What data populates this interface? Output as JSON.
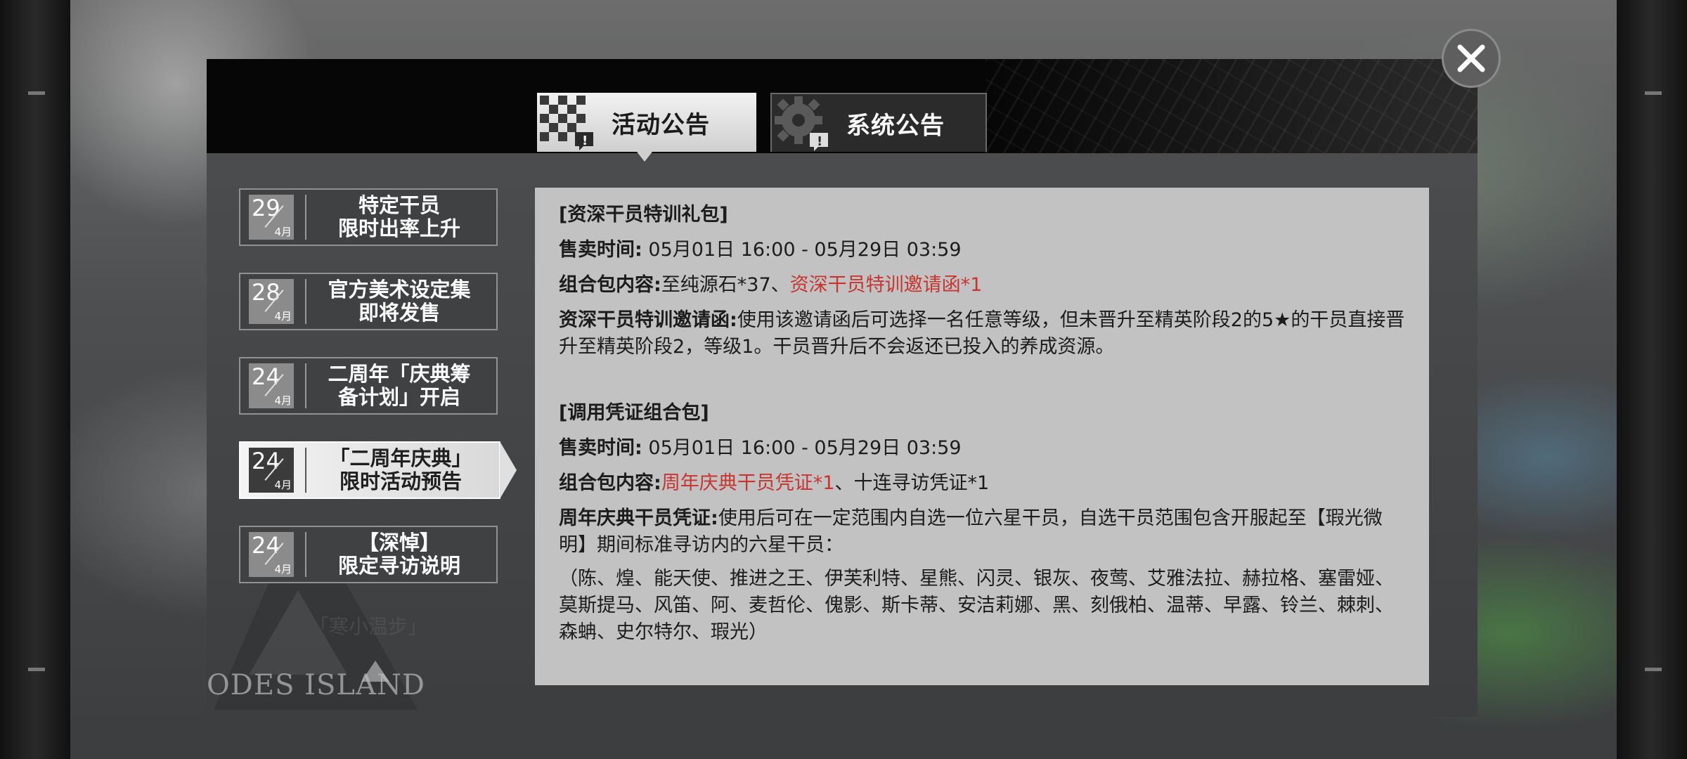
{
  "tabs": {
    "activity": "活动公告",
    "system": "系统公告"
  },
  "news": [
    {
      "day": "29",
      "month": "4月",
      "line1": "特定干员",
      "line2": "限时出率上升"
    },
    {
      "day": "28",
      "month": "4月",
      "line1": "官方美术设定集",
      "line2": "即将发售"
    },
    {
      "day": "24",
      "month": "4月",
      "line1": "二周年「庆典筹",
      "line2": "备计划」开启"
    },
    {
      "day": "24",
      "month": "4月",
      "line1": "「二周年庆典」",
      "line2": "限时活动预告"
    },
    {
      "day": "24",
      "month": "4月",
      "line1": "【深悼】",
      "line2": "限定寻访说明"
    }
  ],
  "news_partial": "「寒小温步」",
  "logo_text": "ODES ISLAND",
  "content": {
    "pack1": {
      "title": "[资深干员特训礼包]",
      "sale_label": "售卖时间:",
      "sale_value": "05月01日 16:00 - 05月29日 03:59",
      "contents_label": "组合包内容:",
      "contents_plain": "至纯源石*37、",
      "contents_red": "资深干员特训邀请函*1",
      "desc_label": "资深干员特训邀请函:",
      "desc_text": "使用该邀请函后可选择一名任意等级，但未晋升至精英阶段2的5★的干员直接晋升至精英阶段2，等级1。干员晋升后不会返还已投入的养成资源。"
    },
    "pack2": {
      "title": "[调用凭证组合包]",
      "sale_label": "售卖时间:",
      "sale_value": "05月01日 16:00 - 05月29日 03:59",
      "contents_label": "组合包内容:",
      "contents_red": "周年庆典干员凭证*1",
      "contents_plain": "、十连寻访凭证*1",
      "desc_label": "周年庆典干员凭证:",
      "desc_text": "使用后可在一定范围内自选一位六星干员，自选干员范围包含开服起至【瑕光微明】期间标准寻访内的六星干员：",
      "operators": "（陈、煌、能天使、推进之王、伊芙利特、星熊、闪灵、银灰、夜莺、艾雅法拉、赫拉格、塞雷娅、莫斯提马、风笛、阿、麦哲伦、傀影、斯卡蒂、安洁莉娜、黑、刻俄柏、温蒂、早露、铃兰、棘刺、森蚺、史尔特尔、瑕光）"
    }
  }
}
